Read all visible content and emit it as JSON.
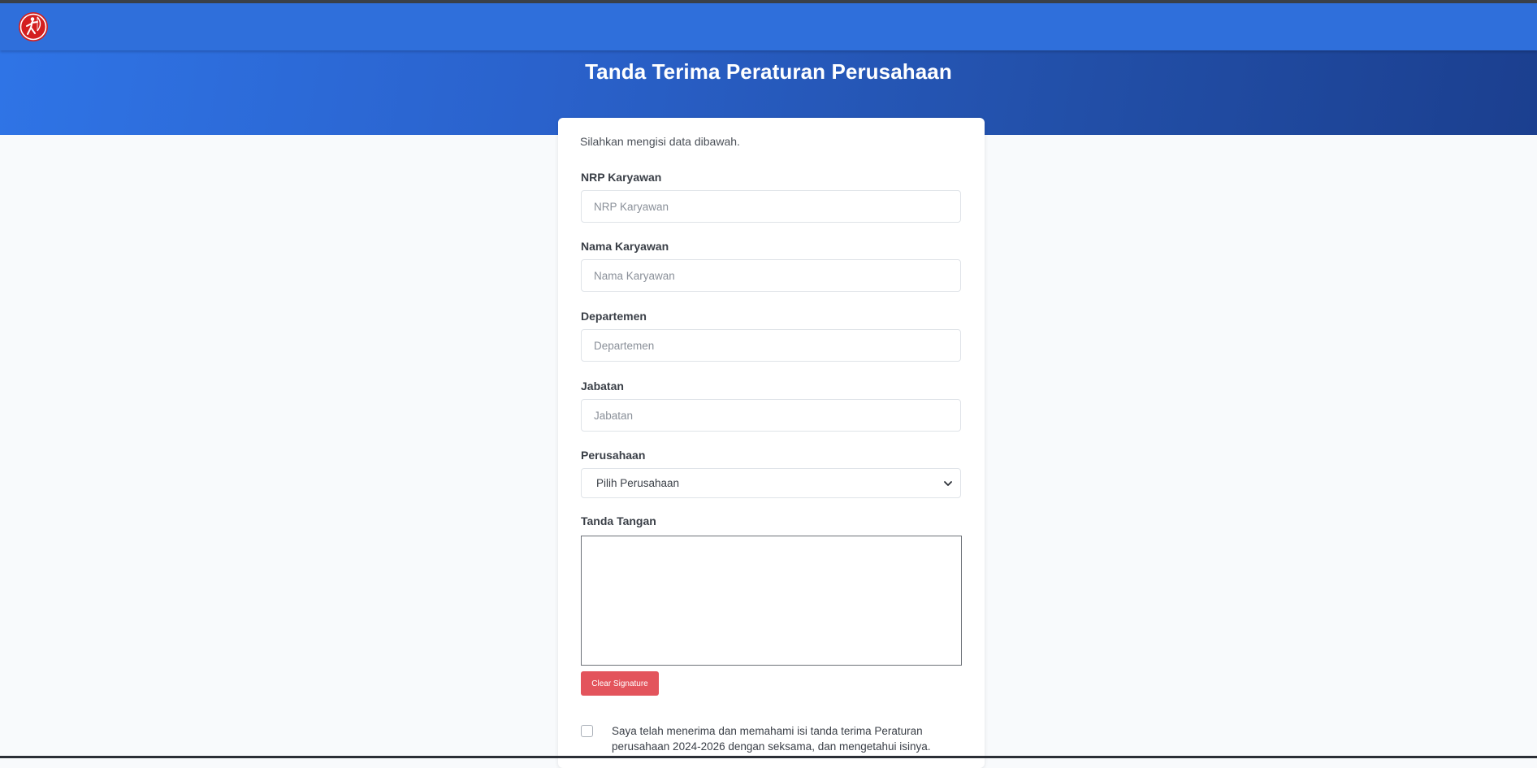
{
  "header": {
    "title": "Tanda Terima Peraturan Perusahaan",
    "logo_icon": "archer-logo-icon"
  },
  "form": {
    "intro": "Silahkan mengisi data dibawah.",
    "nrp": {
      "label": "NRP Karyawan",
      "placeholder": "NRP Karyawan",
      "value": ""
    },
    "nama": {
      "label": "Nama Karyawan",
      "placeholder": "Nama Karyawan",
      "value": ""
    },
    "departemen": {
      "label": "Departemen",
      "placeholder": "Departemen",
      "value": ""
    },
    "jabatan": {
      "label": "Jabatan",
      "placeholder": "Jabatan",
      "value": ""
    },
    "perusahaan": {
      "label": "Perusahaan",
      "selected": "Pilih Perusahaan"
    },
    "signature": {
      "label": "Tanda Tangan",
      "clear_label": "Clear Signature"
    },
    "agreement": {
      "text": "Saya telah menerima dan memahami isi tanda terima Peraturan perusahaan 2024-2026 dengan seksama, dan mengetahui isinya.",
      "checked": false
    }
  },
  "colors": {
    "navbar": "#2f6fdb",
    "hero_start": "#2f74e6",
    "hero_end": "#1b3f8f",
    "danger": "#e3545c",
    "logo": "#d41f1f"
  }
}
